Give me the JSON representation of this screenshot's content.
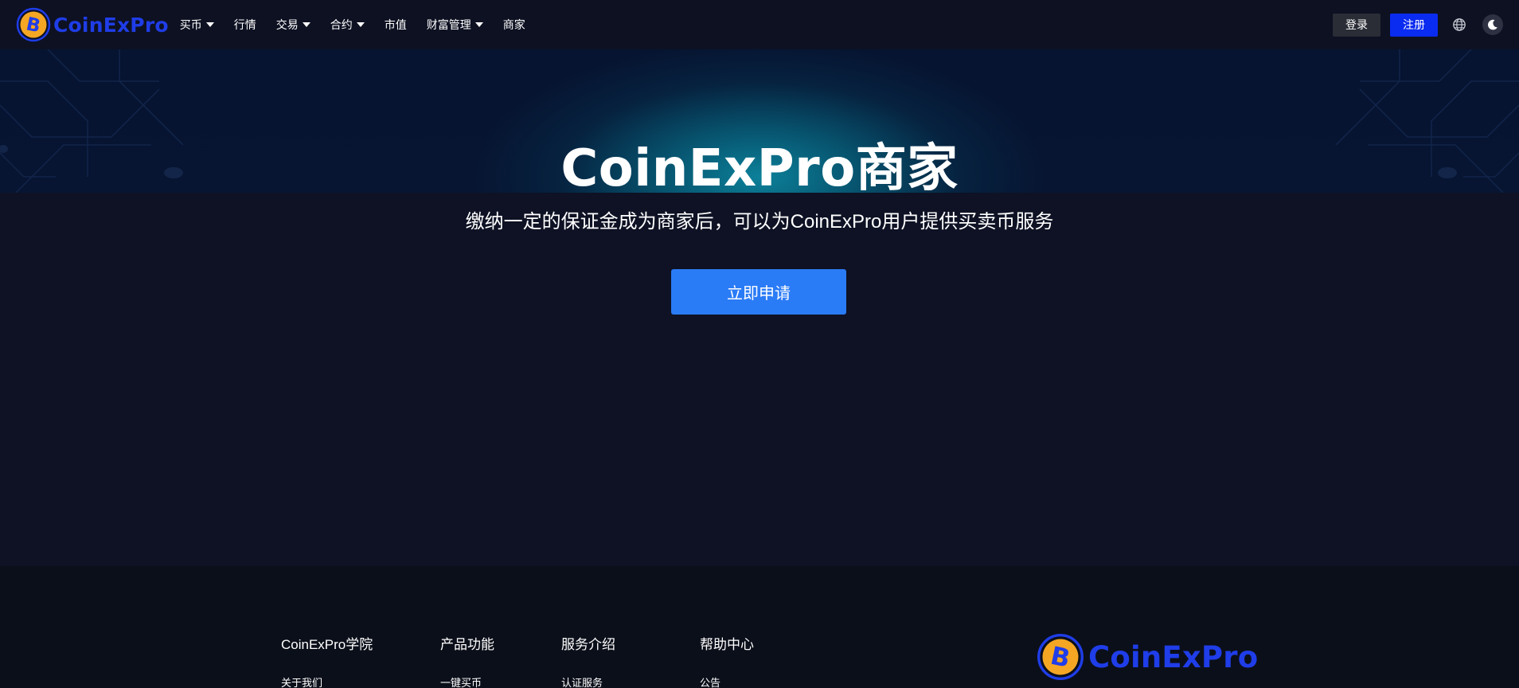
{
  "brand": {
    "name": "CoinExPro",
    "primary_color": "#1f3de8",
    "coin_color": "#f5a623"
  },
  "nav": {
    "items": [
      {
        "label": "买币",
        "dropdown": true
      },
      {
        "label": "行情",
        "dropdown": false
      },
      {
        "label": "交易",
        "dropdown": true
      },
      {
        "label": "合约",
        "dropdown": true
      },
      {
        "label": "市值",
        "dropdown": false
      },
      {
        "label": "财富管理",
        "dropdown": true
      },
      {
        "label": "商家",
        "dropdown": false
      }
    ]
  },
  "auth": {
    "login_label": "登录",
    "register_label": "注册"
  },
  "tools": {
    "language_icon": "globe-icon",
    "theme_icon": "moon-icon"
  },
  "hero": {
    "title": "CoinExPro商家",
    "subtitle": "缴纳一定的保证金成为商家后，可以为CoinExPro用户提供买卖币服务",
    "apply_label": "立即申请"
  },
  "footer": {
    "columns": [
      {
        "heading": "CoinExPro学院",
        "first_link": "关于我们"
      },
      {
        "heading": "产品功能",
        "first_link": "一键买币"
      },
      {
        "heading": "服务介绍",
        "first_link": "认证服务"
      },
      {
        "heading": "帮助中心",
        "first_link": "公告"
      }
    ],
    "logo_text": "CoinExPro"
  }
}
